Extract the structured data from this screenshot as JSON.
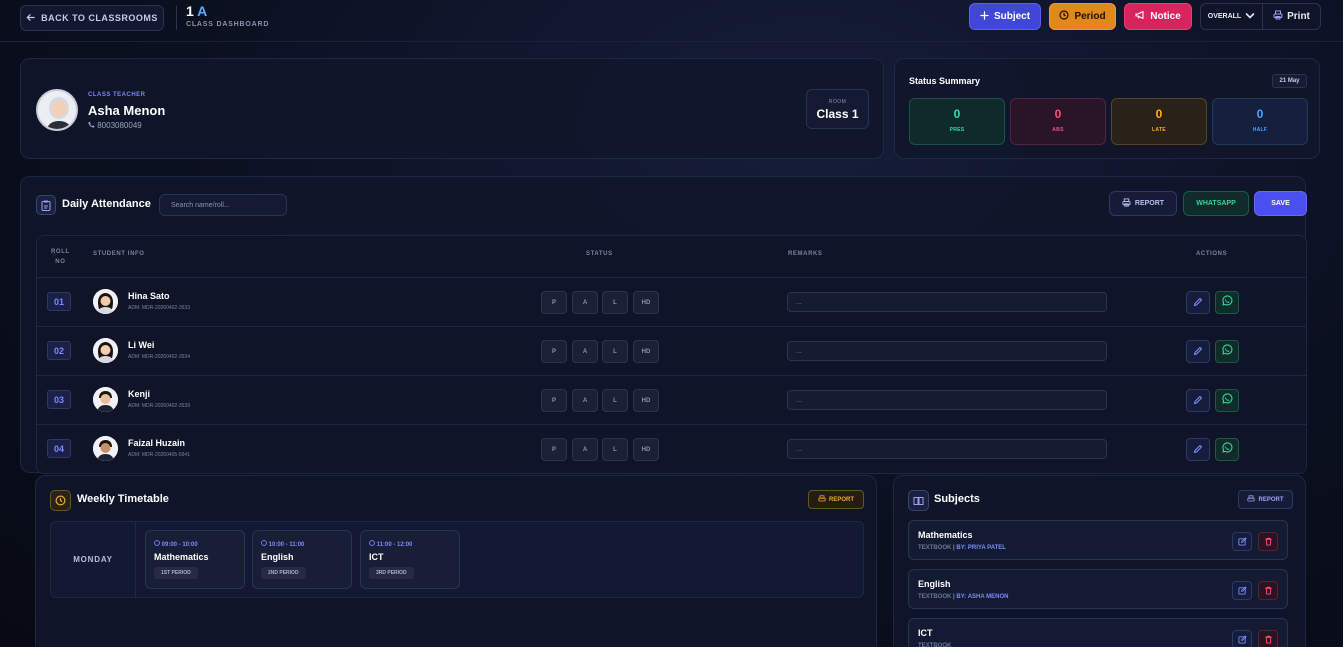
{
  "topbar": {
    "back_label": "BACK TO CLASSROOMS",
    "class_grade": "1",
    "class_section": "A",
    "class_subtitle": "CLASS DASHBOARD",
    "subject_btn": "Subject",
    "period_btn": "Period",
    "notice_btn": "Notice",
    "scope_select": "OVERALL",
    "print_btn": "Print"
  },
  "teacher": {
    "label": "CLASS TEACHER",
    "name": "Asha Menon",
    "phone": "8003080049",
    "room_label": "ROOM",
    "room_value": "Class 1"
  },
  "status_summary": {
    "title": "Status Summary",
    "date": "21 May",
    "items": [
      {
        "count": "0",
        "label": "PRES",
        "color": "#2ee0a6"
      },
      {
        "count": "0",
        "label": "ABS",
        "color": "#ff4f7e"
      },
      {
        "count": "0",
        "label": "LATE",
        "color": "#ffb020"
      },
      {
        "count": "0",
        "label": "HALF",
        "color": "#4da3ff"
      }
    ]
  },
  "attendance": {
    "title": "Daily Attendance",
    "search_placeholder": "Search name/roll...",
    "report_btn": "REPORT",
    "whatsapp_btn": "WHATSAPP",
    "save_btn": "SAVE",
    "columns": {
      "roll_line1": "ROLL",
      "roll_line2": "NO",
      "student": "STUDENT INFO",
      "status": "STATUS",
      "remarks": "REMARKS",
      "actions": "ACTIONS"
    },
    "status_options": [
      "P",
      "A",
      "L",
      "HD"
    ],
    "remarks_placeholder": "...",
    "students": [
      {
        "roll": "01",
        "name": "Hina Sato",
        "adm": "ADM: MDR-20260402-3533",
        "gender": "f"
      },
      {
        "roll": "02",
        "name": "Li Wei",
        "adm": "ADM: MDR-20260402-3534",
        "gender": "f"
      },
      {
        "roll": "03",
        "name": "Kenji",
        "adm": "ADM: MDR-20260402-3539",
        "gender": "m"
      },
      {
        "roll": "04",
        "name": "Faizal Huzain",
        "adm": "ADM: MDR-20260405-5941",
        "gender": "m"
      }
    ]
  },
  "timetable": {
    "title": "Weekly Timetable",
    "report_btn": "REPORT",
    "day": "MONDAY",
    "periods": [
      {
        "time": "09:00 - 10:00",
        "subject": "Mathematics",
        "tag": "1ST PERIOD"
      },
      {
        "time": "10:00 - 11:00",
        "subject": "English",
        "tag": "2ND PERIOD"
      },
      {
        "time": "11:00 - 12:00",
        "subject": "ICT",
        "tag": "3RD PERIOD"
      }
    ]
  },
  "subjects": {
    "title": "Subjects",
    "report_btn": "REPORT",
    "items": [
      {
        "name": "Mathematics",
        "type": "TEXTBOOK",
        "by": "| BY: PRIYA PATEL"
      },
      {
        "name": "English",
        "type": "TEXTBOOK",
        "by": "| BY: ASHA MENON"
      },
      {
        "name": "ICT",
        "type": "TEXTBOOK",
        "by": ""
      }
    ]
  }
}
